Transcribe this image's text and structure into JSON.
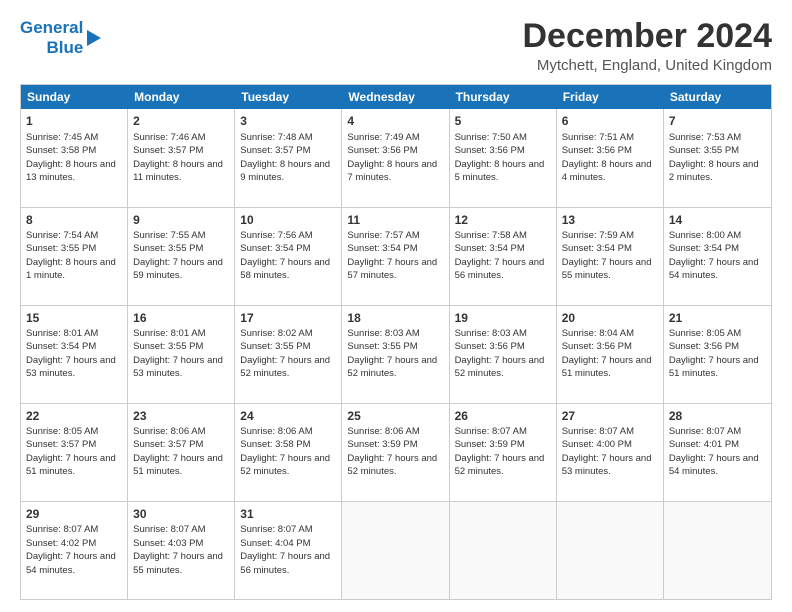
{
  "logo": {
    "line1": "General",
    "line2": "Blue"
  },
  "title": "December 2024",
  "location": "Mytchett, England, United Kingdom",
  "days": [
    "Sunday",
    "Monday",
    "Tuesday",
    "Wednesday",
    "Thursday",
    "Friday",
    "Saturday"
  ],
  "weeks": [
    [
      {
        "num": "1",
        "rise": "7:45 AM",
        "set": "3:58 PM",
        "daylight": "8 hours and 13 minutes."
      },
      {
        "num": "2",
        "rise": "7:46 AM",
        "set": "3:57 PM",
        "daylight": "8 hours and 11 minutes."
      },
      {
        "num": "3",
        "rise": "7:48 AM",
        "set": "3:57 PM",
        "daylight": "8 hours and 9 minutes."
      },
      {
        "num": "4",
        "rise": "7:49 AM",
        "set": "3:56 PM",
        "daylight": "8 hours and 7 minutes."
      },
      {
        "num": "5",
        "rise": "7:50 AM",
        "set": "3:56 PM",
        "daylight": "8 hours and 5 minutes."
      },
      {
        "num": "6",
        "rise": "7:51 AM",
        "set": "3:56 PM",
        "daylight": "8 hours and 4 minutes."
      },
      {
        "num": "7",
        "rise": "7:53 AM",
        "set": "3:55 PM",
        "daylight": "8 hours and 2 minutes."
      }
    ],
    [
      {
        "num": "8",
        "rise": "7:54 AM",
        "set": "3:55 PM",
        "daylight": "8 hours and 1 minute."
      },
      {
        "num": "9",
        "rise": "7:55 AM",
        "set": "3:55 PM",
        "daylight": "7 hours and 59 minutes."
      },
      {
        "num": "10",
        "rise": "7:56 AM",
        "set": "3:54 PM",
        "daylight": "7 hours and 58 minutes."
      },
      {
        "num": "11",
        "rise": "7:57 AM",
        "set": "3:54 PM",
        "daylight": "7 hours and 57 minutes."
      },
      {
        "num": "12",
        "rise": "7:58 AM",
        "set": "3:54 PM",
        "daylight": "7 hours and 56 minutes."
      },
      {
        "num": "13",
        "rise": "7:59 AM",
        "set": "3:54 PM",
        "daylight": "7 hours and 55 minutes."
      },
      {
        "num": "14",
        "rise": "8:00 AM",
        "set": "3:54 PM",
        "daylight": "7 hours and 54 minutes."
      }
    ],
    [
      {
        "num": "15",
        "rise": "8:01 AM",
        "set": "3:54 PM",
        "daylight": "7 hours and 53 minutes."
      },
      {
        "num": "16",
        "rise": "8:01 AM",
        "set": "3:55 PM",
        "daylight": "7 hours and 53 minutes."
      },
      {
        "num": "17",
        "rise": "8:02 AM",
        "set": "3:55 PM",
        "daylight": "7 hours and 52 minutes."
      },
      {
        "num": "18",
        "rise": "8:03 AM",
        "set": "3:55 PM",
        "daylight": "7 hours and 52 minutes."
      },
      {
        "num": "19",
        "rise": "8:03 AM",
        "set": "3:56 PM",
        "daylight": "7 hours and 52 minutes."
      },
      {
        "num": "20",
        "rise": "8:04 AM",
        "set": "3:56 PM",
        "daylight": "7 hours and 51 minutes."
      },
      {
        "num": "21",
        "rise": "8:05 AM",
        "set": "3:56 PM",
        "daylight": "7 hours and 51 minutes."
      }
    ],
    [
      {
        "num": "22",
        "rise": "8:05 AM",
        "set": "3:57 PM",
        "daylight": "7 hours and 51 minutes."
      },
      {
        "num": "23",
        "rise": "8:06 AM",
        "set": "3:57 PM",
        "daylight": "7 hours and 51 minutes."
      },
      {
        "num": "24",
        "rise": "8:06 AM",
        "set": "3:58 PM",
        "daylight": "7 hours and 52 minutes."
      },
      {
        "num": "25",
        "rise": "8:06 AM",
        "set": "3:59 PM",
        "daylight": "7 hours and 52 minutes."
      },
      {
        "num": "26",
        "rise": "8:07 AM",
        "set": "3:59 PM",
        "daylight": "7 hours and 52 minutes."
      },
      {
        "num": "27",
        "rise": "8:07 AM",
        "set": "4:00 PM",
        "daylight": "7 hours and 53 minutes."
      },
      {
        "num": "28",
        "rise": "8:07 AM",
        "set": "4:01 PM",
        "daylight": "7 hours and 54 minutes."
      }
    ],
    [
      {
        "num": "29",
        "rise": "8:07 AM",
        "set": "4:02 PM",
        "daylight": "7 hours and 54 minutes."
      },
      {
        "num": "30",
        "rise": "8:07 AM",
        "set": "4:03 PM",
        "daylight": "7 hours and 55 minutes."
      },
      {
        "num": "31",
        "rise": "8:07 AM",
        "set": "4:04 PM",
        "daylight": "7 hours and 56 minutes."
      },
      null,
      null,
      null,
      null
    ]
  ]
}
